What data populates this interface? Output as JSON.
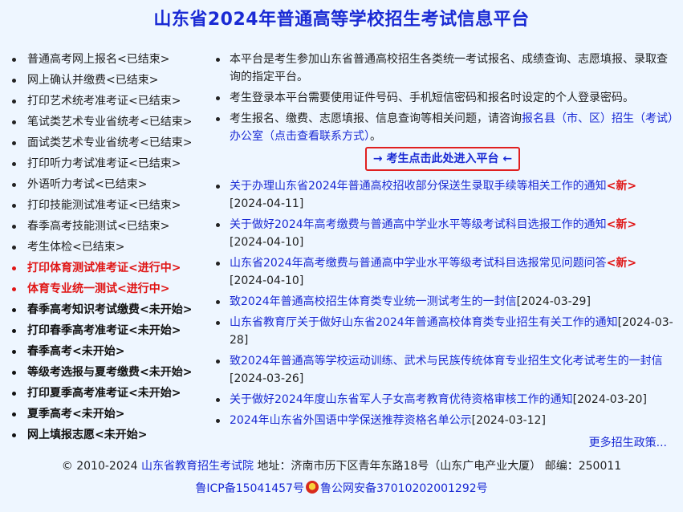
{
  "page_title": "山东省2024年普通高等学校招生考试信息平台",
  "schedule": [
    {
      "text": "普通高考网上报名<已结束>",
      "status": "ended"
    },
    {
      "text": "网上确认并缴费<已结束>",
      "status": "ended"
    },
    {
      "text": "打印艺术统考准考证<已结束>",
      "status": "ended"
    },
    {
      "text": "笔试类艺术专业省统考<已结束>",
      "status": "ended"
    },
    {
      "text": "面试类艺术专业省统考<已结束>",
      "status": "ended"
    },
    {
      "text": "打印听力考试准考证<已结束>",
      "status": "ended"
    },
    {
      "text": "外语听力考试<已结束>",
      "status": "ended"
    },
    {
      "text": "打印技能测试准考证<已结束>",
      "status": "ended"
    },
    {
      "text": "春季高考技能测试<已结束>",
      "status": "ended"
    },
    {
      "text": "考生体检<已结束>",
      "status": "ended"
    },
    {
      "text": "打印体育测试准考证<进行中>",
      "status": "ongoing"
    },
    {
      "text": "体育专业统一测试<进行中>",
      "status": "ongoing"
    },
    {
      "text": "春季高考知识考试缴费<未开始>",
      "status": "upcoming"
    },
    {
      "text": "打印春季高考准考证<未开始>",
      "status": "upcoming"
    },
    {
      "text": "春季高考<未开始>",
      "status": "upcoming"
    },
    {
      "text": "等级考选报与夏考缴费<未开始>",
      "status": "upcoming"
    },
    {
      "text": "打印夏季高考准考证<未开始>",
      "status": "upcoming"
    },
    {
      "text": "夏季高考<未开始>",
      "status": "upcoming"
    },
    {
      "text": "网上填报志愿<未开始>",
      "status": "upcoming"
    }
  ],
  "info": {
    "item1": "本平台是考生参加山东省普通高校招生各类统一考试报名、成绩查询、志愿填报、录取查询的指定平台。",
    "item2": "考生登录本平台需要使用证件号码、手机短信密码和报名时设定的个人登录密码。",
    "item3_prefix": "考生报名、缴费、志愿填报、信息查询等相关问题，请咨询",
    "item3_link": "报名县（市、区）招生（考试）办公室（点击查看联系方式）",
    "item3_suffix": "。"
  },
  "enter_button": "→ 考生点击此处进入平台 ←",
  "news": [
    {
      "title": "关于办理山东省2024年普通高校招收部分保送生录取手续等相关工作的通知",
      "new": "<新>",
      "date": "[2024-04-11]"
    },
    {
      "title": "关于做好2024年高考缴费与普通高中学业水平等级考试科目选报工作的通知",
      "new": "<新>",
      "date": "[2024-04-10]"
    },
    {
      "title": "山东省2024年高考缴费与普通高中学业水平等级考试科目选报常见问题问答",
      "new": "<新>",
      "date": "[2024-04-10]"
    },
    {
      "title": "致2024年普通高校招生体育类专业统一测试考生的一封信",
      "new": "",
      "date": "[2024-03-29]"
    },
    {
      "title": "山东省教育厅关于做好山东省2024年普通高校体育类专业招生有关工作的通知",
      "new": "",
      "date": "[2024-03-28]"
    },
    {
      "title": "致2024年普通高等学校运动训练、武术与民族传统体育专业招生文化考试考生的一封信",
      "new": "",
      "date": "[2024-03-26]"
    },
    {
      "title": "关于做好2024年度山东省军人子女高考教育优待资格审核工作的通知",
      "new": "",
      "date": "[2024-03-20]"
    },
    {
      "title": "2024年山东省外国语中学保送推荐资格名单公示",
      "new": "",
      "date": "[2024-03-12]"
    }
  ],
  "more_link": "更多招生政策...",
  "footer": {
    "copyright": "© 2010-2024",
    "org": "山东省教育招生考试院",
    "address": "地址：济南市历下区青年东路18号（山东广电产业大厦）  邮编：250011",
    "icp": "鲁ICP备15041457号",
    "police": "鲁公网安备37010202001292号"
  },
  "colors": {
    "link": "#1a2ad4",
    "ongoing": "#e01515",
    "highlight_border": "#e02020",
    "background": "#eef6ff"
  }
}
